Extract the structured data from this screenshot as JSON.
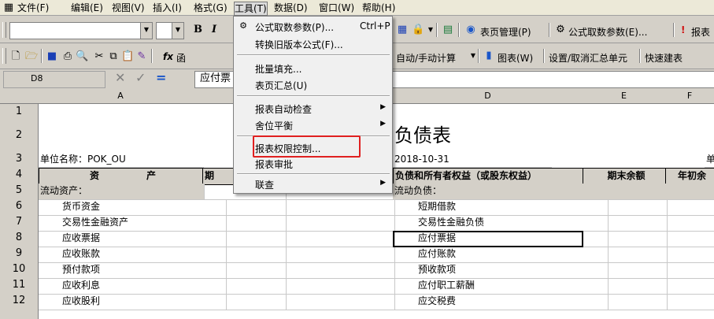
{
  "menubar": {
    "items": [
      "文件(F)",
      "编辑(E)",
      "视图(V)",
      "插入(I)",
      "格式(G)",
      "工具(T)",
      "数据(D)",
      "窗口(W)",
      "帮助(H)"
    ]
  },
  "toolbar1": {
    "bold": "B",
    "italic": "I",
    "report_manage": "表页管理(P)",
    "formula_param": "公式取数参数(E)...",
    "report_label": "报表"
  },
  "toolbar2": {
    "fx": "fx",
    "fx_partial": "函",
    "auto_calc": "自动/手动计算",
    "chart": "图表(W)",
    "set_summary": "设置/取消汇总单元",
    "quick_table": "快速建表"
  },
  "formula_bar": {
    "cell_ref": "D8",
    "content": "应付票"
  },
  "tools_menu": {
    "items": [
      {
        "label": "公式取数参数(P)...",
        "shortcut": "Ctrl+P"
      },
      {
        "label": "转换旧版本公式(F)..."
      },
      {
        "label": "批量填充..."
      },
      {
        "label": "表页汇总(U)"
      },
      {
        "label": "报表自动检查"
      },
      {
        "label": "舍位平衡"
      },
      {
        "label": "报表权限控制..."
      },
      {
        "label": "报表审批"
      },
      {
        "label": "联查"
      }
    ]
  },
  "sheet": {
    "columns": [
      "A",
      "D",
      "E",
      "F"
    ],
    "rows": [
      "1",
      "2",
      "3",
      "4",
      "5",
      "6",
      "7",
      "8",
      "9",
      "10",
      "11",
      "12"
    ],
    "title": "负债表",
    "unit_label": "单位名称：POK_OU",
    "date": "2018-10-31",
    "unit_right": "单",
    "header_assets": "资　　　　　产",
    "header_period": "期",
    "header_liab": "负债和所有者权益（或股东权益）",
    "header_end": "期末余额",
    "header_begin": "年初余",
    "col_a": [
      "流动资产：",
      "货币资金",
      "交易性金融资产",
      "应收票据",
      "应收账款",
      "预付款项",
      "应收利息",
      "应收股利"
    ],
    "col_d": [
      "流动负债：",
      "短期借款",
      "交易性金融负债",
      "应付票据",
      "应付账款",
      "预收款项",
      "应付职工薪酬",
      "应交税费"
    ]
  }
}
